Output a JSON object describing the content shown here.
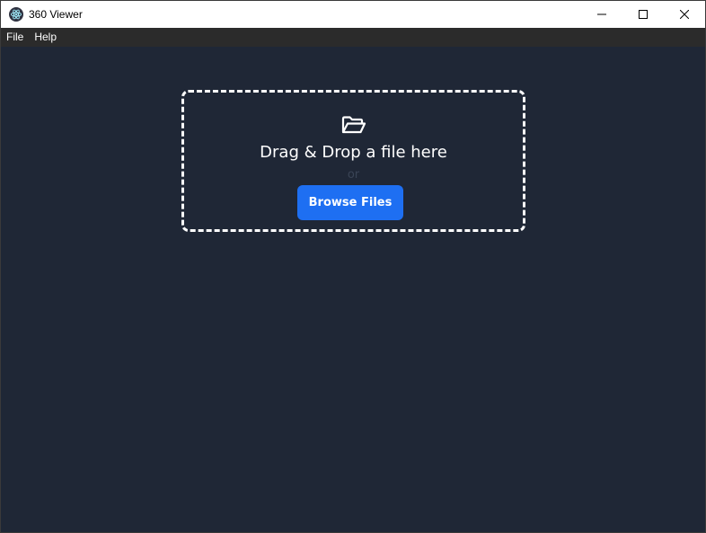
{
  "window": {
    "title": "360 Viewer"
  },
  "menu": {
    "items": [
      {
        "label": "File"
      },
      {
        "label": "Help"
      }
    ]
  },
  "dropzone": {
    "icon": "folder-open-icon",
    "prompt": "Drag & Drop a file here",
    "separator": "or",
    "browse_label": "Browse Files"
  },
  "colors": {
    "background": "#1f2736",
    "menubar": "#2b2b2b",
    "accent": "#1e6ff2",
    "dropzone_border": "#ffffff"
  }
}
